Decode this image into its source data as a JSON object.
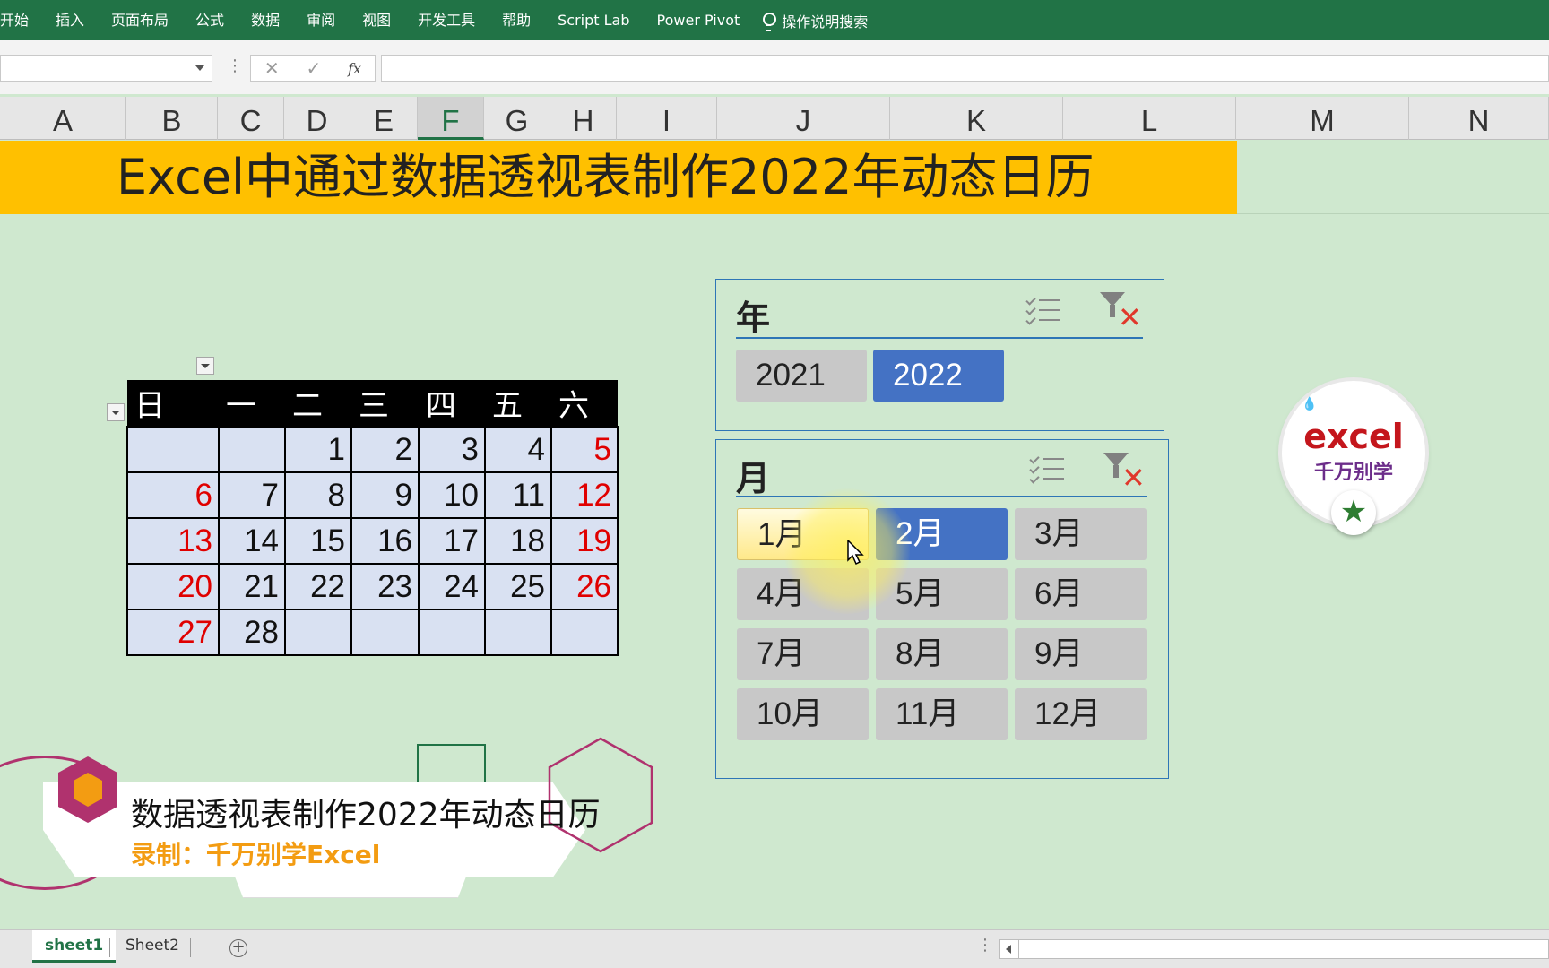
{
  "ribbon": {
    "tabs": [
      "开始",
      "插入",
      "页面布局",
      "公式",
      "数据",
      "审阅",
      "视图",
      "开发工具",
      "帮助",
      "Script Lab",
      "Power Pivot"
    ],
    "search_label": "操作说明搜索"
  },
  "formula_bar": {
    "cancel": "✕",
    "enter": "✓",
    "fx": "fx"
  },
  "columns": [
    "A",
    "B",
    "C",
    "D",
    "E",
    "F",
    "G",
    "H",
    "I",
    "J",
    "K",
    "L",
    "M",
    "N"
  ],
  "selected_column": "F",
  "banner_title": "Excel中通过数据透视表制作2022年动态日历",
  "calendar": {
    "weekdays": [
      "日",
      "一",
      "二",
      "三",
      "四",
      "五",
      "六"
    ],
    "rows": [
      [
        "",
        "",
        "1",
        "2",
        "3",
        "4",
        "5"
      ],
      [
        "6",
        "7",
        "8",
        "9",
        "10",
        "11",
        "12"
      ],
      [
        "13",
        "14",
        "15",
        "16",
        "17",
        "18",
        "19"
      ],
      [
        "20",
        "21",
        "22",
        "23",
        "24",
        "25",
        "26"
      ],
      [
        "27",
        "28",
        "",
        "",
        "",
        "",
        ""
      ]
    ],
    "weekend_color": "#e00000"
  },
  "slicer_year": {
    "title": "年",
    "items": [
      {
        "label": "2021",
        "selected": false
      },
      {
        "label": "2022",
        "selected": true
      }
    ]
  },
  "slicer_month": {
    "title": "月",
    "items": [
      {
        "label": "1月",
        "selected": false,
        "hover": true
      },
      {
        "label": "2月",
        "selected": true
      },
      {
        "label": "3月",
        "selected": false
      },
      {
        "label": "4月",
        "selected": false
      },
      {
        "label": "5月",
        "selected": false
      },
      {
        "label": "6月",
        "selected": false
      },
      {
        "label": "7月",
        "selected": false
      },
      {
        "label": "8月",
        "selected": false
      },
      {
        "label": "9月",
        "selected": false
      },
      {
        "label": "10月",
        "selected": false
      },
      {
        "label": "11月",
        "selected": false
      },
      {
        "label": "12月",
        "selected": false
      }
    ]
  },
  "logo": {
    "line1": "excel",
    "line2": "千万别学",
    "star": "★"
  },
  "overlay": {
    "title": "数据透视表制作2022年动态日历",
    "subtitle": "录制：千万别学Excel"
  },
  "sheets": {
    "tabs": [
      {
        "label": "sheet1",
        "active": true
      },
      {
        "label": "Sheet2",
        "active": false
      }
    ],
    "add": "+"
  },
  "colors": {
    "ribbon": "#217346",
    "background": "#cfe8cf",
    "banner": "#ffc000",
    "slicer_selected": "#4472c4",
    "slicer_item": "#c8c8c8"
  }
}
